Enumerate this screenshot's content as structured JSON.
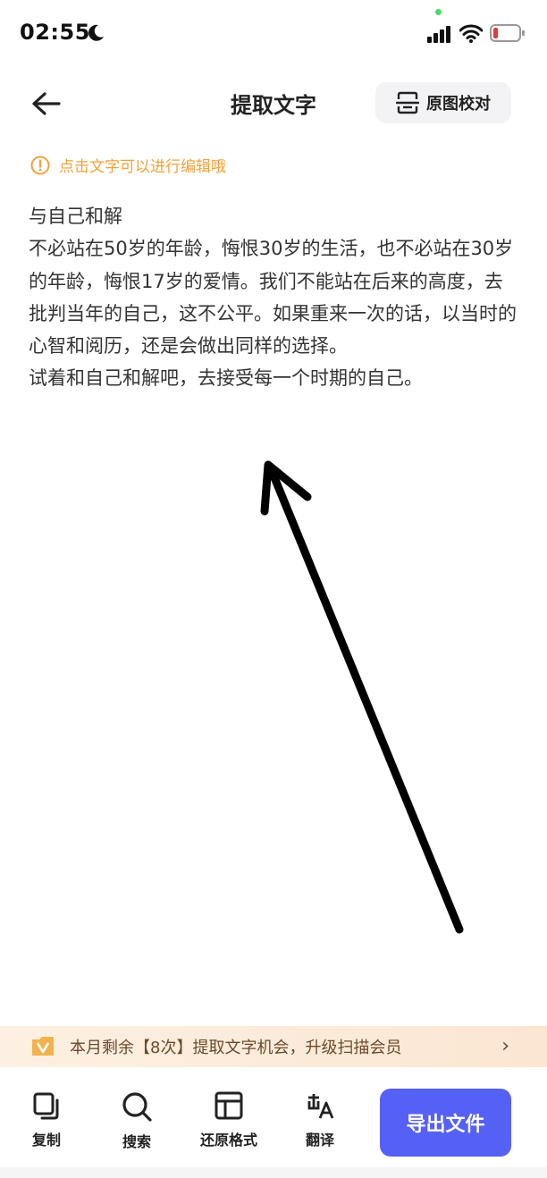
{
  "status_bar": {
    "time": "02:55"
  },
  "header": {
    "title": "提取文字",
    "compare_label": "原图校对"
  },
  "hint": {
    "text": "点击文字可以进行编辑哦"
  },
  "content": {
    "paragraphs": [
      "与自己和解",
      "不必站在50岁的年龄，悔恨30岁的生活，也不必站在30岁的年龄，悔恨17岁的爱情。我们不能站在后来的高度，去批判当年的自己，这不公平。如果重来一次的话，以当时的心智和阅历，还是会做出同样的选择。",
      "试着和自己和解吧，去接受每一个时期的自己。"
    ]
  },
  "promo": {
    "text": "本月剩余【8次】提取文字机会，升级扫描会员",
    "chevron": "›"
  },
  "toolbar": {
    "copy_label": "复制",
    "search_label": "搜索",
    "restore_label": "还原格式",
    "translate_label": "翻译",
    "export_label": "导出文件"
  },
  "colors": {
    "accent": "#5560f5",
    "hint": "#f0a23a",
    "promo_text": "#6b4a2c"
  }
}
